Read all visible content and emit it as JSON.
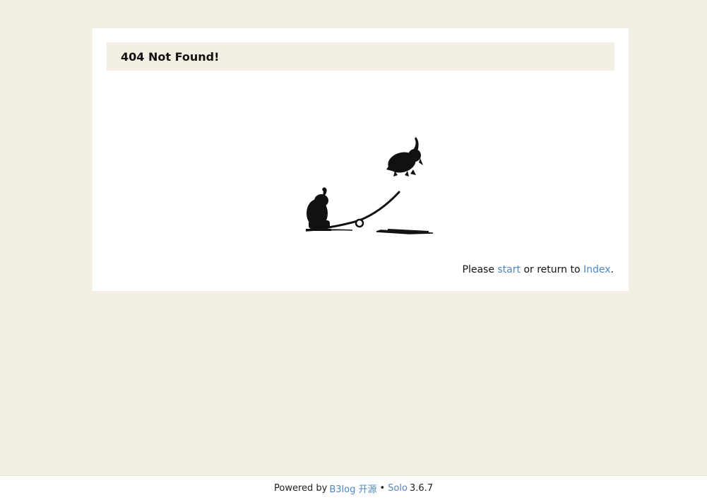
{
  "card": {
    "title": "404 Not Found!"
  },
  "illustration": {
    "icon": "elephants-seesaw-illustration",
    "ink_color": "#111111"
  },
  "message": {
    "prefix": "Please",
    "start_link": "start",
    "middle": "or return to",
    "index_link": "Index",
    "suffix": "."
  },
  "footer": {
    "powered_by": "Powered by",
    "b3log_link": "B3log 开源",
    "bullet": "•",
    "solo_link": "Solo",
    "version": "3.6.7"
  },
  "colors": {
    "background": "#f3f0e3",
    "card": "#ffffff",
    "link": "#4f86c6"
  }
}
